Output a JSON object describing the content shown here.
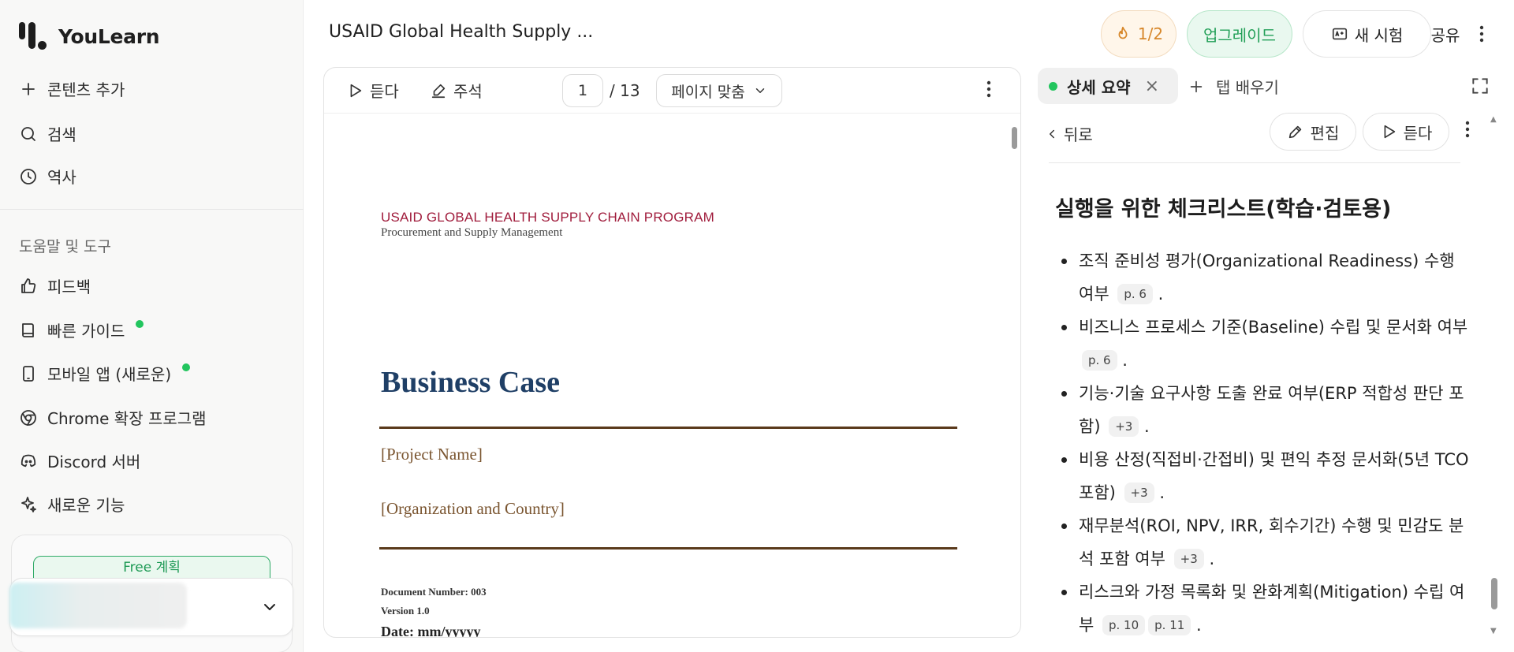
{
  "app": {
    "name": "YouLearn"
  },
  "sidebar": {
    "add_content": "콘텐츠 추가",
    "search": "검색",
    "history": "역사",
    "section_title": "도움말 및 도구",
    "feedback": "피드백",
    "quick_guide": "빠른 가이드",
    "mobile_app": "모바일 앱 (새로운)",
    "chrome_ext": "Chrome 확장 프로그램",
    "discord": "Discord 서버",
    "new_features": "새로운 기능",
    "plan_label": "Free 계획"
  },
  "header": {
    "doc_title": "USAID Global Health Supply ...",
    "streak": "1/2",
    "upgrade": "업그레이드",
    "new_test": "새 시험",
    "share": "공유"
  },
  "viewer": {
    "listen": "듣다",
    "annotate": "주석",
    "page_current": "1",
    "page_total": "/ 13",
    "zoom": "페이지 맞춤"
  },
  "pdf": {
    "org": "USAID GLOBAL HEALTH SUPPLY CHAIN PROGRAM",
    "sub": "Procurement and Supply Management",
    "title": "Business Case",
    "project_name": "[Project Name]",
    "org_country": "[Organization and Country]",
    "doc_number": "Document Number:  003",
    "version": "Version 1.0",
    "date": "Date: mm/yyyyy"
  },
  "panel": {
    "tab_summary": "상세 요약",
    "tab_learn": "탭 배우기",
    "back": "뒤로",
    "edit": "편집",
    "listen": "듣다",
    "heading": "실행을 위한 체크리스트(학습·검토용)",
    "items": [
      {
        "text": "조직 준비성 평가(Organizational Readiness) 수행 여부",
        "cites": [
          "p. 6"
        ]
      },
      {
        "text": "비즈니스 프로세스 기준(Baseline) 수립 및 문서화 여부",
        "cites": [
          "p. 6"
        ]
      },
      {
        "text": "기능·기술 요구사항 도출 완료 여부(ERP 적합성 판단 포함)",
        "cites": [
          "+3"
        ]
      },
      {
        "text": "비용 산정(직접비·간접비) 및 편익 추정 문서화(5년 TCO 포함)",
        "cites": [
          "+3"
        ]
      },
      {
        "text": "재무분석(ROI, NPV, IRR, 회수기간) 수행 및 민감도 분석 포함 여부",
        "cites": [
          "+3"
        ]
      },
      {
        "text": "리스크와 가정 목록화 및 완화계획(Mitigation) 수립 여부",
        "cites": [
          "p. 10",
          "p. 11"
        ]
      }
    ]
  },
  "colors": {
    "accent_green": "#22c55e",
    "upgrade_green": "#23a058",
    "streak_orange": "#d7872a",
    "pdf_org_red": "#a01c3c",
    "pdf_title_blue": "#1f3f66"
  }
}
